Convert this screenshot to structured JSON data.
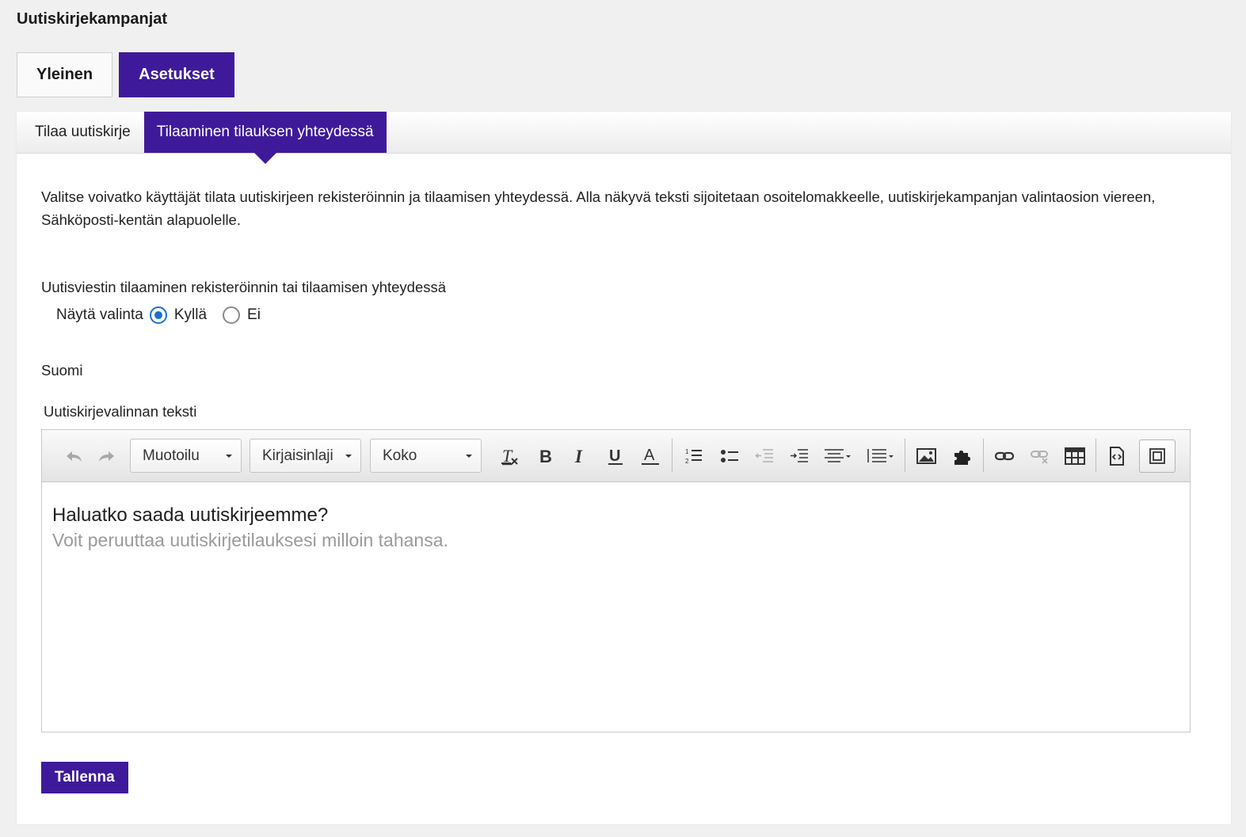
{
  "page": {
    "title": "Uutiskirjekampanjat"
  },
  "top_tabs": [
    {
      "label": "Yleinen",
      "active": false
    },
    {
      "label": "Asetukset",
      "active": true
    }
  ],
  "sub_tabs": [
    {
      "label": "Tilaa uutiskirje",
      "active": false
    },
    {
      "label": "Tilaaminen tilauksen yhteydessä",
      "active": true
    }
  ],
  "description": "Valitse voivatko käyttäjät tilata uutiskirjeen rekisteröinnin ja tilaamisen yhteydessä. Alla näkyvä teksti sijoitetaan osoitelomakkeelle, uutiskirjekampanjan valintaosion viereen, Sähköposti-kentän alapuolelle.",
  "subscription_field": {
    "label": "Uutisviestin tilaaminen rekisteröinnin tai tilaamisen yhteydessä",
    "option_label": "Näytä valinta",
    "options": [
      {
        "label": "Kyllä",
        "checked": true
      },
      {
        "label": "Ei",
        "checked": false
      }
    ]
  },
  "language": {
    "label": "Suomi"
  },
  "editor": {
    "label": "Uutiskirjevalinnan teksti",
    "format_dropdown": "Muotoilu",
    "font_dropdown": "Kirjaisinlaji",
    "size_dropdown": "Koko",
    "content_heading": "Haluatko saada uutiskirjeemme?",
    "content_sub": "Voit peruuttaa uutiskirjetilauksesi milloin tahansa."
  },
  "save_button": {
    "label": "Tallenna"
  },
  "colors": {
    "accent": "#3e1a9a",
    "radio": "#1a6fd6"
  }
}
